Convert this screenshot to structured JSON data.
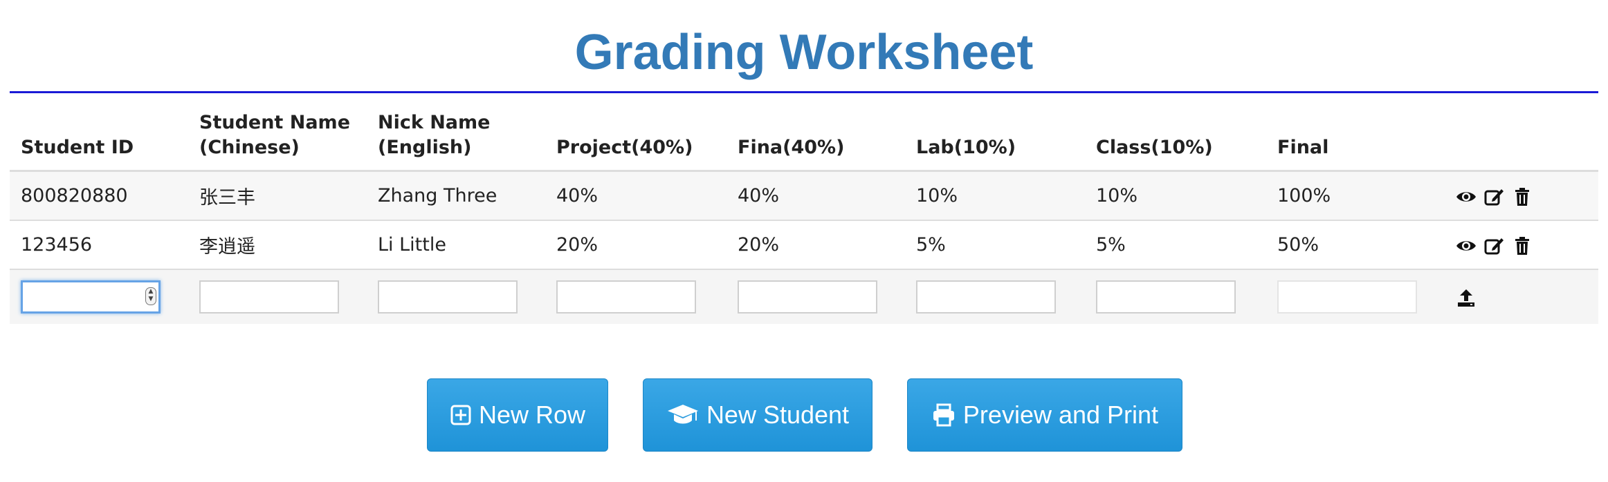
{
  "title": "Grading Worksheet",
  "columns": [
    {
      "line1": "Student ID",
      "line2": ""
    },
    {
      "line1": "Student Name",
      "line2": "(Chinese)"
    },
    {
      "line1": "Nick Name",
      "line2": "(English)"
    },
    {
      "line1": "Project(40%)",
      "line2": ""
    },
    {
      "line1": "Fina(40%)",
      "line2": ""
    },
    {
      "line1": "Lab(10%)",
      "line2": ""
    },
    {
      "line1": "Class(10%)",
      "line2": ""
    },
    {
      "line1": "Final",
      "line2": ""
    }
  ],
  "rows": [
    {
      "student_id": "800820880",
      "name_cn": "张三丰",
      "nick": "Zhang Three",
      "project": "40%",
      "final_exam": "40%",
      "lab": "10%",
      "class": "10%",
      "final": "100%"
    },
    {
      "student_id": "123456",
      "name_cn": "李逍遥",
      "nick": "Li Little",
      "project": "20%",
      "final_exam": "20%",
      "lab": "5%",
      "class": "5%",
      "final": "50%"
    }
  ],
  "icons": {
    "view": "eye-icon",
    "edit": "edit-icon",
    "delete": "trash-icon",
    "upload": "upload-icon",
    "new_row": "plus-square-icon",
    "new_student": "graduation-cap-icon",
    "print": "print-icon"
  },
  "buttons": {
    "new_row": "New Row",
    "new_student": "New Student",
    "preview_print": "Preview and Print"
  },
  "colors": {
    "title": "#337ab7",
    "rule": "#1a1ad6",
    "button": "#2a9fe0"
  }
}
